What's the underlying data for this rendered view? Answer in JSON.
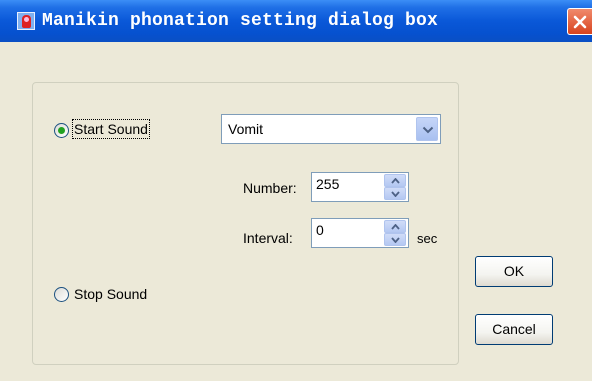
{
  "window": {
    "title": "Manikin phonation setting dialog box"
  },
  "options": {
    "start_sound": {
      "label": "Start Sound",
      "selected": true
    },
    "stop_sound": {
      "label": "Stop Sound",
      "selected": false
    }
  },
  "sound_select": {
    "value": "Vomit"
  },
  "number": {
    "label": "Number:",
    "value": "255"
  },
  "interval": {
    "label": "Interval:",
    "value": "0",
    "unit": "sec"
  },
  "buttons": {
    "ok": "OK",
    "cancel": "Cancel"
  },
  "icons": {
    "app": "manikin-app-icon",
    "close": "close-icon",
    "dropdown": "chevron-down-icon",
    "spin_up": "spin-up-icon",
    "spin_down": "spin-down-icon"
  },
  "colors": {
    "title_bar": "#0a58d8",
    "close": "#d8431e",
    "radio_dot": "#21a121",
    "dialog_bg": "#ece9d8"
  }
}
